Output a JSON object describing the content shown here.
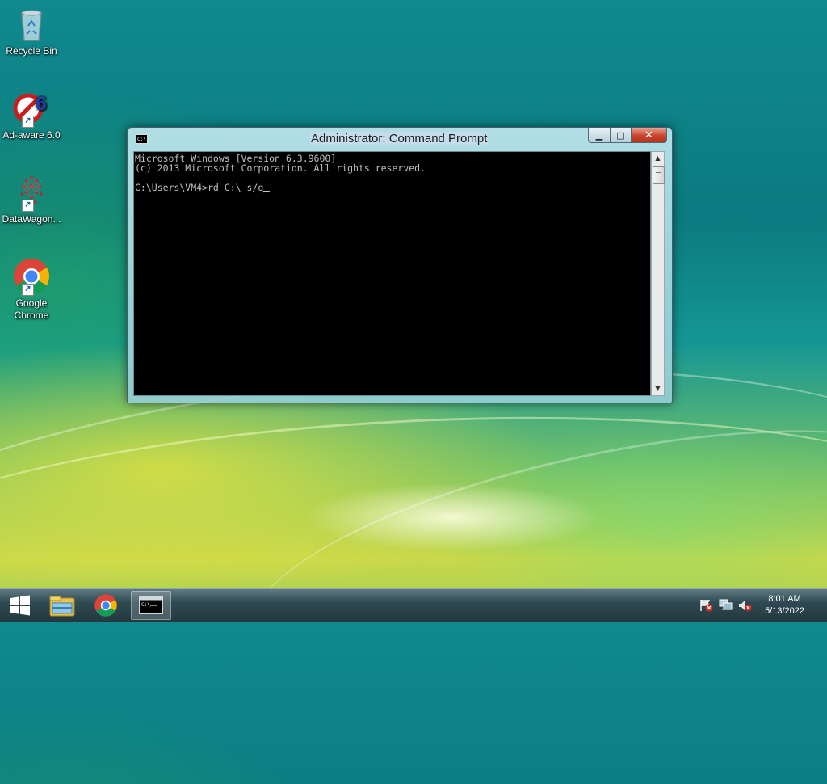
{
  "desktop": {
    "icons": [
      {
        "label": "Recycle Bin",
        "icon": "recycle-bin-icon"
      },
      {
        "label": "Ad-aware 6.0",
        "icon": "ad-aware-icon"
      },
      {
        "label": "DataWagon...",
        "icon": "datawagon-icon"
      },
      {
        "label": "Google Chrome",
        "icon": "chrome-icon"
      }
    ]
  },
  "window": {
    "title": "Administrator: Command Prompt",
    "console_lines": [
      "Microsoft Windows [Version 6.3.9600]",
      "(c) 2013 Microsoft Corporation. All rights reserved.",
      "",
      "C:\\Users\\VM4>rd C:\\ s/q"
    ],
    "buttons": {
      "minimize": "minimize-icon",
      "maximize": "maximize-icon",
      "close": "close-icon"
    }
  },
  "taskbar": {
    "items": [
      "start-icon",
      "file-explorer-icon",
      "chrome-icon",
      "command-prompt-icon"
    ],
    "tray": [
      "action-center-icon",
      "network-icon",
      "volume-muted-icon"
    ],
    "clock": {
      "time": "8:01 AM",
      "date": "5/13/2022"
    }
  },
  "colors": {
    "console_bg": "#000000",
    "console_text": "#c0c0c0",
    "close_button": "#c8442c",
    "taskbar": "#2f4a52"
  }
}
